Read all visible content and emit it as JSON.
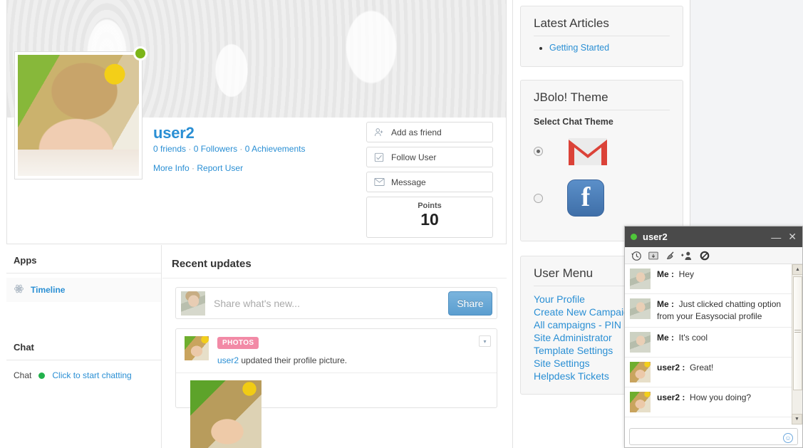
{
  "profile": {
    "username": "user2",
    "stats": {
      "friends": "0 friends",
      "followers": "0 Followers",
      "achievements": "0 Achievements",
      "separator": "·"
    },
    "links": {
      "more_info": "More Info",
      "report_user": "Report User"
    },
    "actions": [
      {
        "label": "Add as friend",
        "icon": "add-friend-icon"
      },
      {
        "label": "Follow User",
        "icon": "checkbox-icon"
      },
      {
        "label": "Message",
        "icon": "envelope-icon"
      }
    ],
    "points": {
      "label": "Points",
      "value": "10"
    },
    "online_status": "online"
  },
  "sidebar": {
    "apps_heading": "Apps",
    "apps": [
      {
        "label": "Timeline",
        "icon": "atom-icon"
      }
    ],
    "chat_heading": "Chat",
    "chat_row": {
      "key": "Chat",
      "value": "Click to start chatting",
      "status_color": "#22b14c"
    }
  },
  "feed": {
    "title": "Recent updates",
    "share": {
      "placeholder": "Share what's new...",
      "button": "Share"
    },
    "post": {
      "badge": "PHOTOS",
      "author": "user2",
      "text": " updated their profile picture."
    }
  },
  "right": {
    "latest_articles": {
      "title": "Latest Articles",
      "items": [
        "Getting Started"
      ]
    },
    "jbolo": {
      "title": "JBolo! Theme",
      "subtitle": "Select Chat Theme",
      "themes": [
        {
          "name": "gmail",
          "selected": true
        },
        {
          "name": "facebook",
          "selected": false
        }
      ]
    },
    "user_menu": {
      "title": "User Menu",
      "items": [
        "Your Profile",
        "Create New Campaign",
        "All campaigns - PIN",
        "Site Administrator",
        "Template Settings",
        "Site Settings",
        "Helpdesk Tickets"
      ]
    }
  },
  "chat_window": {
    "title": "user2",
    "status_color": "#4fc63a",
    "minimize_label": "—",
    "close_label": "✕",
    "tools": [
      {
        "name": "history-icon",
        "glyph": "🕐"
      },
      {
        "name": "popout-window-icon",
        "glyph": "🗗"
      },
      {
        "name": "clear-broom-icon",
        "glyph": "🧹"
      },
      {
        "name": "add-user-icon",
        "glyph": "👤"
      },
      {
        "name": "block-user-icon",
        "glyph": "🚫"
      }
    ],
    "messages": [
      {
        "who": "Me :",
        "sender": "me",
        "text": "Hey"
      },
      {
        "who": "Me :",
        "sender": "me",
        "text": "Just clicked chatting option from your Easysocial profile"
      },
      {
        "who": "Me :",
        "sender": "me",
        "text": "It's cool"
      },
      {
        "who": "user2 :",
        "sender": "user2",
        "text": "Great!"
      },
      {
        "who": "user2 :",
        "sender": "user2",
        "text": "How you doing?"
      }
    ],
    "input_value": "",
    "emoji_icon": "smiley-icon"
  },
  "colors": {
    "link": "#2a8fd4",
    "badge_pink": "#f28aa6",
    "share_blue": "#5b9ed0",
    "titlebar": "#4a4a4a",
    "online_green": "#22b14c"
  }
}
